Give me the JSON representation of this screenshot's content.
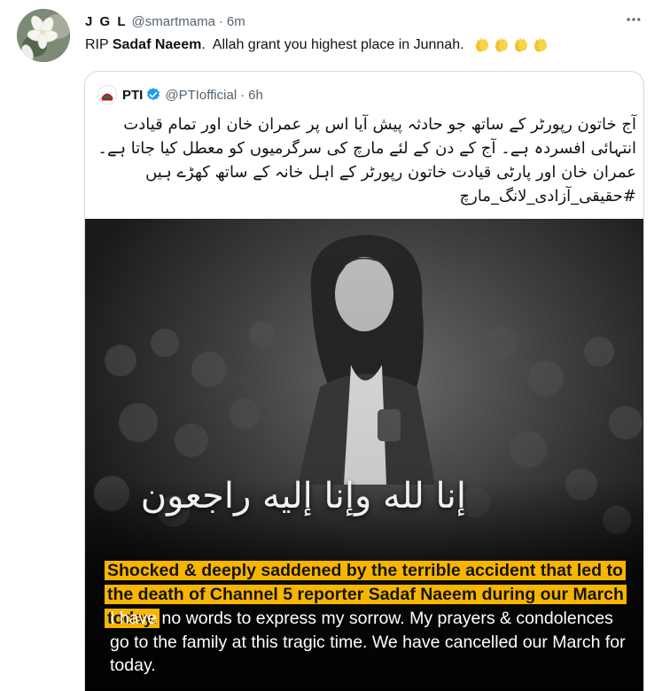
{
  "tweet": {
    "display_name": "J G L",
    "handle": "@smartmama",
    "separator": "·",
    "time": "6m",
    "text_prefix": "RIP ",
    "text_bold": "Sadaf Naeem",
    "text_suffix": ".  Allah grant you highest place in Junnah.",
    "emoji_count": 4,
    "more_icon": "more-dots-icon"
  },
  "quote": {
    "name": "PTI",
    "handle": "@PTIofficial",
    "separator": "·",
    "time": "6h",
    "verified_color": "#1d9bf0",
    "text": "آج خاتون رپورٹر کے ساتھ جو حادثہ پیش آیا اس پر عمران خان اور تمام قیادت انتہائی افسردہ ہے۔ آج کے دن کے لئے مارچ کی سرگرمیوں کو معطل کیا جاتا ہے۔ عمران خان اور پارٹی قیادت خاتون رپورٹر کے اہل خانہ کے ساتھ کھڑے ہیں #حقیقی_آزادی_لانگ_مارچ"
  },
  "image": {
    "calligraphy": "إنا لله وإنا إليه راجعون",
    "headline": "Shocked & deeply saddened by the terrible accident that led to the death of Channel 5 reporter Sadaf Naeem during our March today.",
    "statement": "I have no words to express my sorrow. My prayers & condolences go to the family at this tragic time. We have cancelled our March for today.",
    "highlight_color": "#f7b500"
  },
  "colors": {
    "text_primary": "#0f1419",
    "text_secondary": "#536471",
    "border": "#cfd9de"
  }
}
